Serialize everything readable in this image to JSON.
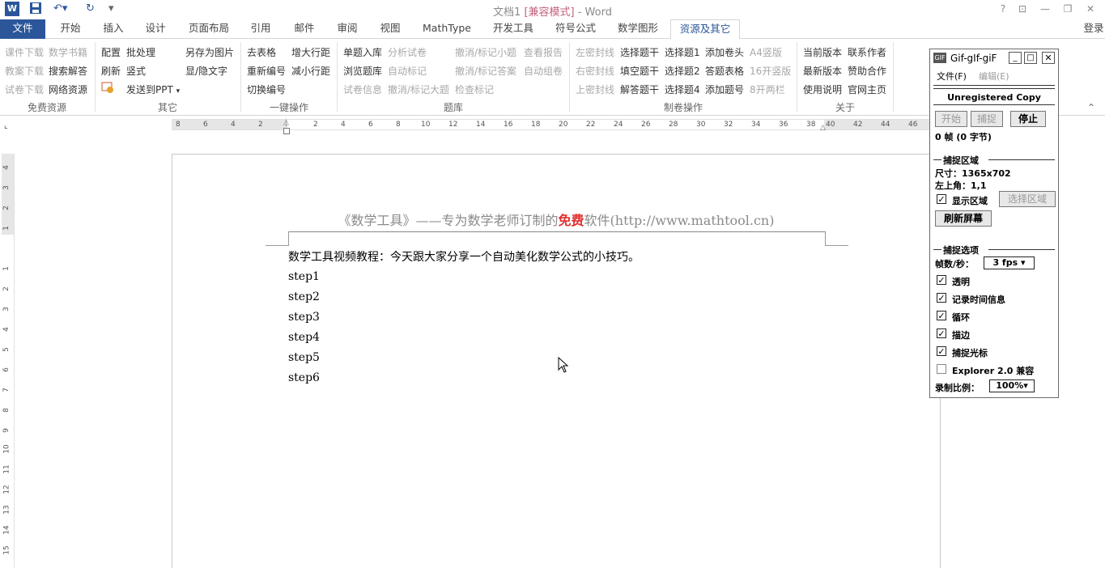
{
  "titlebar": {
    "doc_name": "文档1",
    "compat": "[兼容模式]",
    "app": " - Word",
    "help": "?",
    "login": "登录"
  },
  "tabs": [
    {
      "label": "文件"
    },
    {
      "label": "开始"
    },
    {
      "label": "插入"
    },
    {
      "label": "设计"
    },
    {
      "label": "页面布局"
    },
    {
      "label": "引用"
    },
    {
      "label": "邮件"
    },
    {
      "label": "审阅"
    },
    {
      "label": "视图"
    },
    {
      "label": "MathType"
    },
    {
      "label": "开发工具"
    },
    {
      "label": "符号公式"
    },
    {
      "label": "数学图形"
    },
    {
      "label": "资源及其它"
    }
  ],
  "ribbon": {
    "free": {
      "label": "免费资源",
      "items": [
        "课件下载",
        "数学书籍",
        "教案下载",
        "搜索解答",
        "试卷下载",
        "网络资源"
      ]
    },
    "other": {
      "label": "其它",
      "items": [
        "配置",
        "批处理",
        "另存为图片",
        "刷新",
        "竖式",
        "显/隐文字",
        "发送到PPT"
      ]
    },
    "onekey": {
      "label": "一键操作",
      "items": [
        "去表格",
        "增大行距",
        "重新编号",
        "减小行距",
        "切换编号"
      ]
    },
    "bank": {
      "label": "题库",
      "items": [
        "单题入库",
        "分析试卷",
        "撤消/标记小题",
        "查看报告",
        "浏览题库",
        "自动标记",
        "撤消/标记答案",
        "自动组卷",
        "试卷信息",
        "撤消/标记大题",
        "检查标记"
      ]
    },
    "make": {
      "label": "制卷操作",
      "items": [
        "左密封线",
        "选择题干",
        "选择题1",
        "添加卷头",
        "A4竖版",
        "右密封线",
        "填空题干",
        "选择题2",
        "答题表格",
        "16开竖版",
        "上密封线",
        "解答题干",
        "选择题4",
        "添加题号",
        "8开两栏"
      ]
    },
    "about": {
      "label": "关于",
      "items": [
        "当前版本",
        "联系作者",
        "最新版本",
        "赞助合作",
        "使用说明",
        "官网主页"
      ]
    }
  },
  "ruler": {
    "h_ticks": [
      "8",
      "6",
      "4",
      "2",
      "2",
      "4",
      "6",
      "8",
      "10",
      "12",
      "14",
      "16",
      "18",
      "20",
      "22",
      "24",
      "26",
      "28",
      "30",
      "32",
      "34",
      "36",
      "38",
      "40",
      "42",
      "44",
      "46"
    ],
    "v_ticks": [
      "4",
      "3",
      "2",
      "1",
      "1",
      "2",
      "3",
      "4",
      "5",
      "6",
      "7",
      "8",
      "9",
      "10",
      "11",
      "12",
      "13",
      "14",
      "15"
    ]
  },
  "document": {
    "header_pre": "《数学工具》——专为数学老师订制的",
    "header_red": "免费",
    "header_post": "软件(http://www.mathtool.cn)",
    "line1": "数学工具视频教程：今天跟大家分享一个自动美化数学公式的小技巧。",
    "steps": [
      "step1",
      "step2",
      "step3",
      "step4",
      "step5",
      "step6"
    ]
  },
  "gif": {
    "title": "Gif-gIf-giF",
    "menu_file": "文件(F)",
    "menu_edit": "编辑(E)",
    "unregistered": "Unregistered Copy",
    "btn_start": "开始",
    "btn_capture": "捕捉",
    "btn_stop": "停止",
    "frames": "0 帧 (0 字节)",
    "section_area": "捕捉区域",
    "size": "尺寸：1365x702",
    "topleft": "左上角：1,1",
    "show_area": "显示区域",
    "select_area": "选择区域",
    "refresh": "刷新屏幕",
    "section_opts": "捕捉选项",
    "fps_label": "帧数/秒：",
    "fps_value": "3 fps",
    "opt_transparent": "透明",
    "opt_time": "记录时间信息",
    "opt_loop": "循环",
    "opt_border": "描边",
    "opt_cursor": "捕捉光标",
    "opt_explorer": "Explorer 2.0 兼容",
    "scale_label": "录制比例：",
    "scale_value": "100%"
  },
  "colors": {
    "accent": "#2b579a",
    "red": "#e03030",
    "compat": "#c2637c"
  }
}
